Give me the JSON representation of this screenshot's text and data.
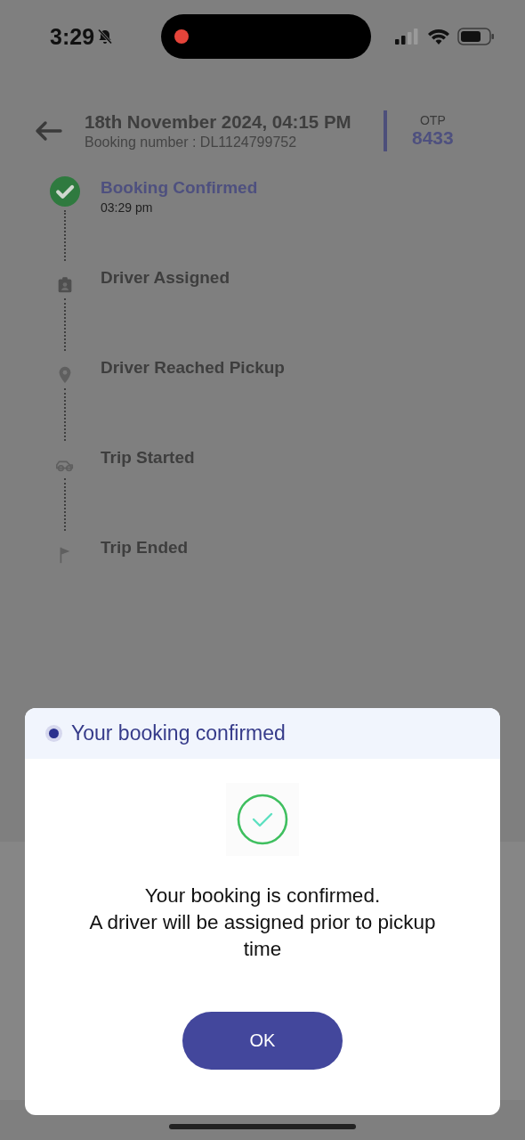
{
  "status_bar": {
    "time": "3:29",
    "silent": true,
    "recording": true
  },
  "header": {
    "title": "18th November 2024, 04:15 PM",
    "booking_number": "Booking number : DL1124799752",
    "otp_label": "OTP",
    "otp": "8433"
  },
  "timeline": [
    {
      "kind": "check",
      "label": "Booking Confirmed",
      "time": "03:29 pm",
      "done": true
    },
    {
      "kind": "badge",
      "label": "Driver Assigned",
      "done": false
    },
    {
      "kind": "pin",
      "label": "Driver Reached Pickup",
      "done": false
    },
    {
      "kind": "car",
      "label": "Trip Started",
      "done": false
    },
    {
      "kind": "flag",
      "label": "Trip Ended",
      "done": false
    }
  ],
  "dialog": {
    "title": "Your booking confirmed",
    "message": "Your booking is confirmed.\nA driver will be assigned prior to pickup time",
    "button": "OK"
  }
}
